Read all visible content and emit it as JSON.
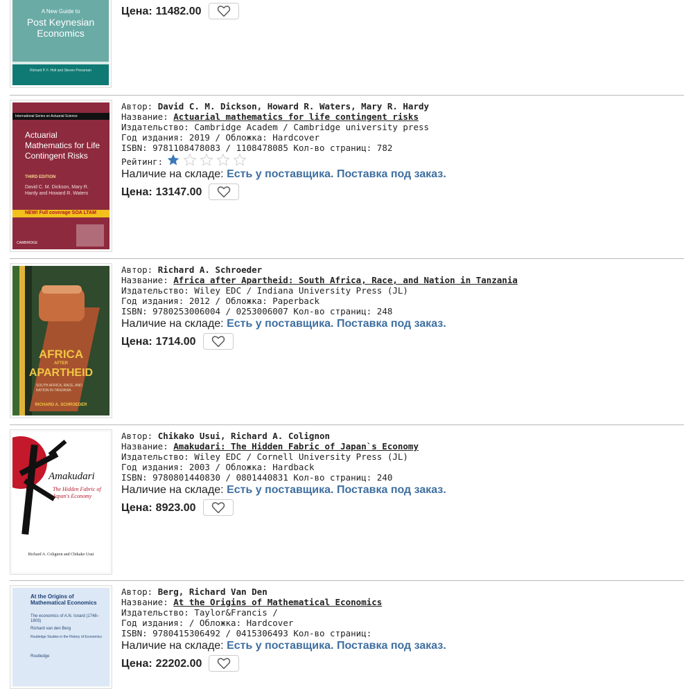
{
  "labels": {
    "author": "Автор:",
    "title": "Название:",
    "publisher": "Издательство:",
    "year": "Год издания:",
    "cover": "Обложка:",
    "isbn": "ISBN:",
    "pages": "Кол-во страниц:",
    "rating": "Рейтинг:",
    "stock": "Наличие на складе:",
    "price": "Цена:"
  },
  "items": [
    {
      "price": "11482.00",
      "cover_title_small": "A New Guide to",
      "cover_title": "Post Keynesian Economics",
      "cover_authors": "Richard P. F. Holt and Steven Pressman"
    },
    {
      "author": "David C. M. Dickson, Howard R. Waters, Mary R. Hardy",
      "title": "Actuarial mathematics for life contingent risks",
      "publisher": "Cambridge Academ / Cambridge university press",
      "year": "2019",
      "binding": "Hardcover",
      "isbn": "9781108478083 / 1108478085",
      "pages": "782",
      "rating": 1,
      "stock": "Есть у поставщика. Поставка под заказ.",
      "price": "13147.00",
      "cover_series": "International Series on Actuarial Science",
      "cover_title": "Actuarial Mathematics for Life Contingent Risks",
      "cover_edition": "THIRD EDITION",
      "cover_authors": "David C. M. Dickson, Mary R. Hardy and Howard R. Waters",
      "cover_banner": "NEW! Full coverage SOA LTAM",
      "cover_publisher": "CAMBRIDGE"
    },
    {
      "author": "Richard A. Schroeder",
      "title": "Africa after Apartheid: South Africa, Race, and Nation in Tanzania",
      "publisher": "Wiley EDC / Indiana University Press (JL)",
      "year": "2012",
      "binding": "Paperback",
      "isbn": "9780253006004 / 0253006007",
      "pages": "248",
      "stock": "Есть у поставщика. Поставка под заказ.",
      "price": "1714.00",
      "cover_title1": "AFRICA",
      "cover_title2": "AFTER",
      "cover_title3": "APARTHEID",
      "cover_subtitle": "SOUTH AFRICA, RACE, AND NATION IN TANZANIA",
      "cover_author": "RICHARD A. SCHROEDER"
    },
    {
      "author": "Chikako Usui, Richard A. Colignon",
      "title": "Amakudari: The Hidden Fabric of Japan`s Economy",
      "publisher": "Wiley EDC / Cornell University Press (JL)",
      "year": "2003",
      "binding": "Hardback",
      "isbn": "9780801440830 / 0801440831",
      "pages": "240",
      "stock": "Есть у поставщика. Поставка под заказ.",
      "price": "8923.00",
      "cover_title": "Amakudari",
      "cover_subtitle": "The Hidden Fabric of Japan's Economy",
      "cover_authors": "Richard A. Colignon and Chikako Usui"
    },
    {
      "author": "Berg, Richard Van Den",
      "title": "At the Origins of Mathematical Economics",
      "publisher": "Taylor&Francis /",
      "year": "",
      "binding": "Hardcover",
      "isbn": "9780415306492 / 0415306493",
      "pages": "",
      "stock": "Есть у поставщика. Поставка под заказ.",
      "price": "22202.00",
      "cover_title": "At the Origins of Mathematical Economics",
      "cover_subtitle": "The economics of A.N. Isnard (1748–1803)",
      "cover_author": "Richard van den Berg",
      "cover_series": "Routledge Studies in the History of Economics",
      "cover_publisher": "Routledge"
    }
  ],
  "colors": {
    "stock_link": "#3f6fa0",
    "star_filled": "#3a78b8",
    "star_empty": "#cfcfcf",
    "separator": "#b8b8b8"
  },
  "icons": {
    "favorite": "heart-outline-icon",
    "rating": "star-icon"
  }
}
